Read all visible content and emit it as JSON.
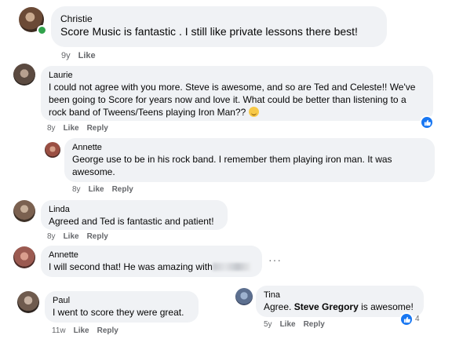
{
  "comments": [
    {
      "name": "Christie",
      "text": "Score Music is fantastic . I still like private lessons there best!",
      "time": "9y",
      "like": "Like"
    },
    {
      "name": "Laurie",
      "lines": [
        "I could not agree with you more. Steve is awesome, and so are Ted and Celeste!! We've",
        "been going to Score for years now and love it. What could be better than listening to a",
        "rock band of Tweens/Teens playing Iron Man??"
      ],
      "time": "8y",
      "like": "Like",
      "reply": "Reply"
    },
    {
      "name": "Annette",
      "lines": [
        "George use to be in his rock band. I remember them playing iron man. It was",
        "awesome."
      ],
      "time": "8y",
      "like": "Like",
      "reply": "Reply"
    },
    {
      "name": "Linda",
      "text": "Agreed and Ted is fantastic and patient!",
      "time": "8y",
      "like": "Like",
      "reply": "Reply"
    },
    {
      "name": "Annette",
      "text": "I will second that! He was amazing with",
      "time": "",
      "more": "···"
    },
    {
      "name": "Paul",
      "text": "I went to score they were great.",
      "time": "11w",
      "like": "Like",
      "reply": "Reply"
    },
    {
      "name": "Tina",
      "text_before": "Agree.",
      "text_bold": "Steve Gregory",
      "text_after": "is awesome!",
      "time": "5y",
      "like": "Like",
      "reply": "Reply",
      "reactions": "4"
    }
  ],
  "colors": {
    "bubble": "#f0f2f5",
    "meta": "#65676b",
    "reaction": "#1877f2",
    "online": "#31a24c"
  }
}
